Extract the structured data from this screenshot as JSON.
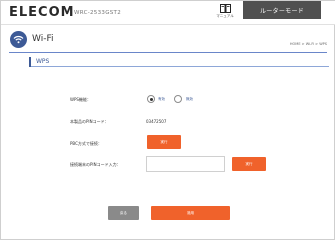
{
  "header": {
    "brand": "ELECOM",
    "model": "WRC-2533GST2",
    "manual_label": "マニュアル",
    "mode_label": "ルーターモード"
  },
  "page": {
    "title": "Wi-Fi",
    "breadcrumb": "HOME > Wi-Fi > WPS",
    "section_label": "WPS"
  },
  "form": {
    "wps_label": "WPS機能：",
    "wps_options": [
      "有効",
      "無効"
    ],
    "wps_selected": "有効",
    "pin_label": "本製品のPINコード：",
    "pin_value": "03472507",
    "pbc_label": "PBC方式で接続：",
    "pbc_button": "実行",
    "client_pin_label": "接続端末のPINコード入力：",
    "client_pin_value": "",
    "client_pin_button": "実行"
  },
  "footer": {
    "back_label": "戻る",
    "apply_label": "適用"
  },
  "colors": {
    "accent_orange": "#f0622b",
    "brand_blue": "#3d5a96",
    "header_button": "#505050"
  }
}
